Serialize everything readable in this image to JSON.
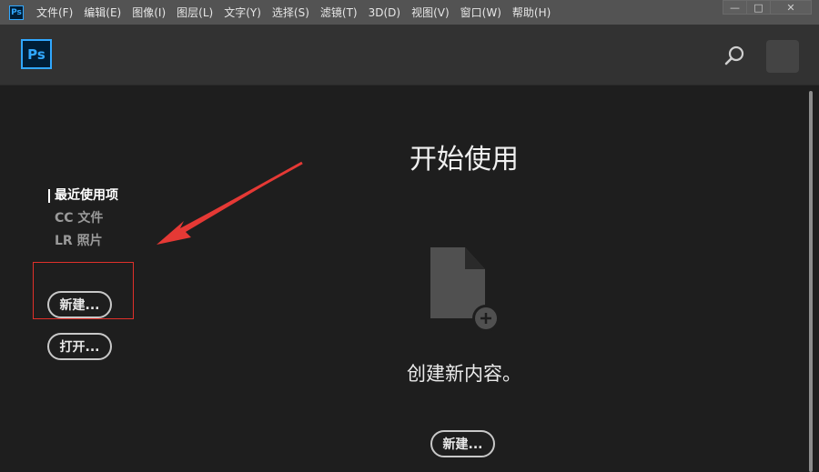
{
  "app": {
    "icon_label": "Ps"
  },
  "menubar": {
    "items": [
      "文件(F)",
      "编辑(E)",
      "图像(I)",
      "图层(L)",
      "文字(Y)",
      "选择(S)",
      "滤镜(T)",
      "3D(D)",
      "视图(V)",
      "窗口(W)",
      "帮助(H)"
    ],
    "window_controls": {
      "minimize": "—",
      "maximize": "□",
      "close": "✕"
    }
  },
  "header": {
    "logo": "Ps",
    "search_icon": "search-icon",
    "avatar": "user-avatar"
  },
  "sidebar": {
    "items": [
      {
        "label": "最近使用项",
        "active": true
      },
      {
        "label": "CC 文件",
        "active": false
      },
      {
        "label": "LR 照片",
        "active": false
      }
    ],
    "new_button": "新建...",
    "open_button": "打开..."
  },
  "main": {
    "title": "开始使用",
    "create_text": "创建新内容。",
    "new_button": "新建..."
  },
  "colors": {
    "menubar_bg": "#535353",
    "header_bg": "#323232",
    "body_bg": "#1e1e1e",
    "ps_blue": "#31a8ff",
    "annotation_red": "#e0302a"
  }
}
